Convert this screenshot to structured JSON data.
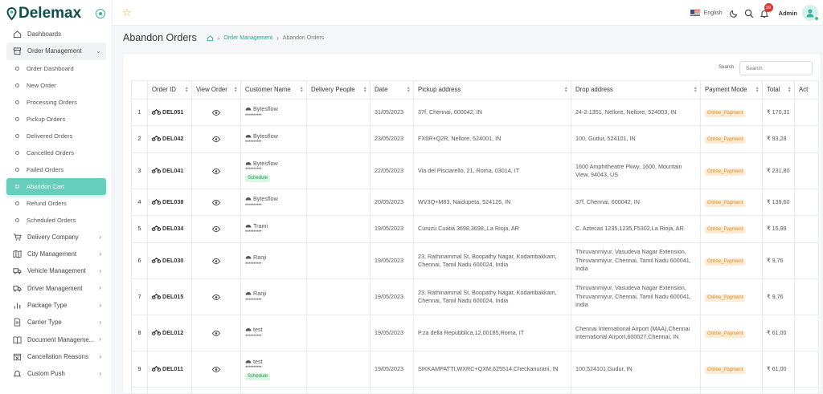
{
  "app": {
    "name": "Delemax"
  },
  "sidebar": {
    "items": [
      {
        "label": "Dashboards",
        "icon": "home-icon"
      },
      {
        "label": "Order Management",
        "icon": "box-icon",
        "open": true
      }
    ],
    "order_submenu": [
      {
        "label": "Order Dashboard"
      },
      {
        "label": "New Order"
      },
      {
        "label": "Processing Orders"
      },
      {
        "label": "Pickup Orders"
      },
      {
        "label": "Delivered Orders"
      },
      {
        "label": "Cancelled Orders"
      },
      {
        "label": "Failed Orders"
      },
      {
        "label": "Abandon Cart",
        "active": true
      },
      {
        "label": "Refund Orders"
      },
      {
        "label": "Scheduled Orders"
      }
    ],
    "more_items": [
      {
        "label": "Delivery Company",
        "icon": "cart-icon"
      },
      {
        "label": "City Management",
        "icon": "map-icon"
      },
      {
        "label": "Vehicle Management",
        "icon": "truck-icon"
      },
      {
        "label": "Driver Management",
        "icon": "truck-icon"
      },
      {
        "label": "Package Type",
        "icon": "bar-chart-icon"
      },
      {
        "label": "Carrier Type",
        "icon": "document-icon"
      },
      {
        "label": "Document Manageme...",
        "icon": "book-icon"
      },
      {
        "label": "Cancellation Reasons",
        "icon": "calendar-x-icon"
      },
      {
        "label": "Custom Push",
        "icon": "bell-icon"
      }
    ]
  },
  "topbar": {
    "language": "English",
    "notification_count": "99",
    "user": "Admin"
  },
  "page": {
    "title": "Abandon Orders",
    "breadcrumb": [
      "Order Management",
      "Abandon Orders"
    ]
  },
  "search": {
    "label": "Search",
    "placeholder": "Search"
  },
  "table": {
    "columns": [
      "",
      "Order ID",
      "View Order",
      "Customer Name",
      "Delivery People",
      "Date",
      "Pickup address",
      "Drop address",
      "Payment Mode",
      "Total",
      "Act"
    ],
    "rows": [
      {
        "no": "1",
        "id": "DEL051",
        "customer": "Bytesflow",
        "mask": "**********",
        "scheduled": "",
        "date": "31/05/2023",
        "pickup": "37f, Chennai, 600042, IN",
        "drop": "24-2-1351, Nellore, Nellore, 524003, IN",
        "payment": "Online_Payment",
        "total": "₹ 170,31"
      },
      {
        "no": "2",
        "id": "DEL042",
        "customer": "Bytesflow",
        "mask": "**********",
        "scheduled": "",
        "date": "23/05/2023",
        "pickup": "FX6R+Q2R, Nellore, 524001, IN",
        "drop": "100, Gudur, 524101, IN",
        "payment": "Online_Payment",
        "total": "₹ 93,28"
      },
      {
        "no": "3",
        "id": "DEL041",
        "customer": "Bytesflow",
        "mask": "**********",
        "scheduled": "Schedule",
        "date": "22/05/2023",
        "pickup": "Via del Pisciarello, 21, Roma, 03014, IT",
        "drop": "1600 Amphitheatre Pkwy, 1600, Mountain View, 94043, US",
        "payment": "Online_Payment",
        "total": "₹ 231,80"
      },
      {
        "no": "4",
        "id": "DEL038",
        "customer": "Bytesflow",
        "mask": "**********",
        "scheduled": "",
        "date": "20/05/2023",
        "pickup": "WV3Q+M83, Naidupeta, 524126, IN",
        "drop": "37f, Chennai, 600042, IN",
        "payment": "Online_Payment",
        "total": "₹ 139,60"
      },
      {
        "no": "5",
        "id": "DEL034",
        "customer": "Trami",
        "mask": "**********",
        "scheduled": "",
        "date": "19/05/2023",
        "pickup": "Curuzú Cuatiá 3698,3698,,La Rioja, AR",
        "drop": "C. Aztecas 1235,1235,F5302,La Rioja, AR",
        "payment": "Online_Payment",
        "total": "₹ 15,99"
      },
      {
        "no": "6",
        "id": "DEL030",
        "customer": "Ranji",
        "mask": "**********",
        "scheduled": "",
        "date": "19/05/2023",
        "pickup": "23, Rathinammal St, Boopathy Nagar, Kodambakkam, Chennai, Tamil Nadu 600024, India",
        "drop": "Thiruvanmiyur, Vasudeva Nagar Extension, Thiruvanmiyur, Chennai, Tamil Nadu 600041, India",
        "payment": "Online_Payment",
        "total": "₹ 9,76"
      },
      {
        "no": "7",
        "id": "DEL015",
        "customer": "Ranji",
        "mask": "**********",
        "scheduled": "",
        "date": "19/05/2023",
        "pickup": "23, Rathinammal St, Boopathy Nagar, Kodambakkam, Chennai, Tamil Nadu 600024, India",
        "drop": "Thiruvanmiyur, Vasudeva Nagar Extension, Thiruvanmiyur, Chennai, Tamil Nadu 600041, India",
        "payment": "Online_Payment",
        "total": "₹ 9,76"
      },
      {
        "no": "8",
        "id": "DEL012",
        "customer": "test",
        "mask": "**********",
        "scheduled": "",
        "date": "19/05/2023",
        "pickup": "P.za della Repubblica,12,00185,Roma, IT",
        "drop": "Chennai International Airport (MAA),Chennai International Airport,600027,Chennai, IN",
        "payment": "Online_Payment",
        "total": "₹ 61,00"
      },
      {
        "no": "9",
        "id": "DEL011",
        "customer": "test",
        "mask": "**********",
        "scheduled": "Schedule",
        "date": "19/05/2023",
        "pickup": "SIKKAMPATTI,WXRC+QXM,625514,Checkanurani, IN",
        "drop": "100,524101,Gudur, IN",
        "payment": "Online_Payment",
        "total": "₹ 61,00"
      }
    ]
  },
  "colors": {
    "accent": "#38b2a3",
    "active_item": "#67cdbd",
    "payment_badge": "#e68a1a",
    "schedule_badge": "#1e9a4b",
    "notification": "#e0342f"
  }
}
